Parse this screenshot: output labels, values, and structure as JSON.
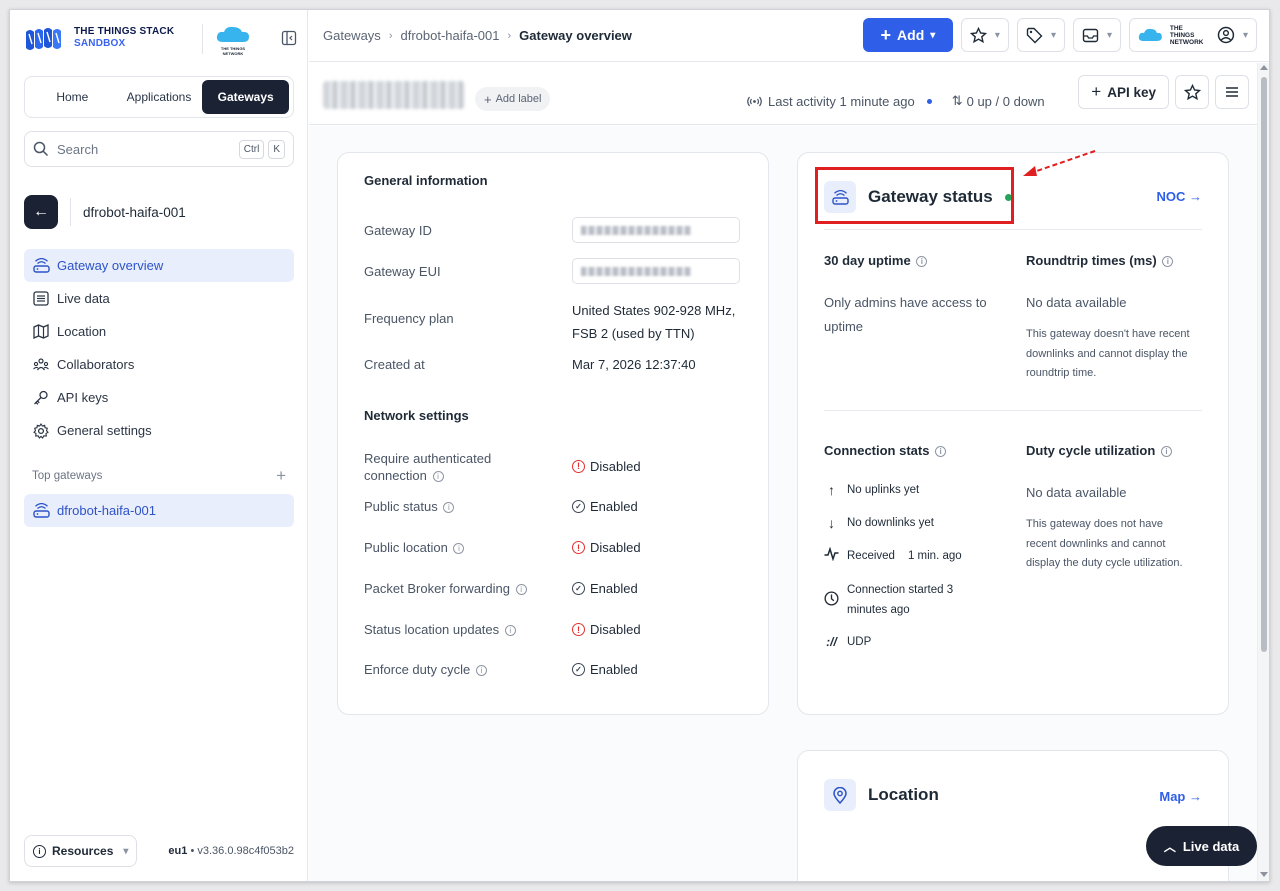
{
  "brand": {
    "line1": "THE THINGS STACK",
    "line2": "SANDBOX",
    "ttn_line1": "THE THINGS",
    "ttn_line2": "NETWORK"
  },
  "nav": {
    "tabs": [
      {
        "label": "Home"
      },
      {
        "label": "Applications"
      },
      {
        "label": "Gateways",
        "active": true
      }
    ]
  },
  "search": {
    "placeholder": "Search",
    "shortcut1": "Ctrl",
    "shortcut2": "K"
  },
  "gateway_nav": {
    "name": "dfrobot-haifa-001",
    "items": [
      {
        "label": "Gateway overview",
        "icon": "router-icon",
        "active": true
      },
      {
        "label": "Live data",
        "icon": "list-icon"
      },
      {
        "label": "Location",
        "icon": "map-icon"
      },
      {
        "label": "Collaborators",
        "icon": "people-icon"
      },
      {
        "label": "API keys",
        "icon": "key-icon"
      },
      {
        "label": "General settings",
        "icon": "gear-icon"
      }
    ]
  },
  "top_gateways": {
    "heading": "Top gateways",
    "items": [
      {
        "label": "dfrobot-haifa-001"
      }
    ]
  },
  "footer": {
    "resources_label": "Resources",
    "region": "eu1",
    "version": "v3.36.0.98c4f053b2"
  },
  "breadcrumbs": [
    {
      "label": "Gateways"
    },
    {
      "label": "dfrobot-haifa-001"
    },
    {
      "label": "Gateway overview"
    }
  ],
  "header": {
    "add_label": "Add",
    "account_ttn_line1": "THE THINGS",
    "account_ttn_line2": "NETWORK"
  },
  "subheader": {
    "add_label": "Add label",
    "last_activity": "Last activity 1 minute ago",
    "traffic": "0 up / 0 down",
    "api_key_label": "API key"
  },
  "general_info": {
    "title": "General information",
    "rows": [
      {
        "label": "Gateway ID"
      },
      {
        "label": "Gateway EUI"
      },
      {
        "label": "Frequency plan",
        "value_line1": "United States 902-928 MHz,",
        "value_line2": "FSB 2 (used by TTN)"
      },
      {
        "label": "Created at",
        "value": "Mar 7, 2026 12:37:40"
      }
    ]
  },
  "network_settings": {
    "title": "Network settings",
    "rows": [
      {
        "label_line1": "Require authenticated",
        "label_line2": "connection",
        "status": "Disabled",
        "enabled": false
      },
      {
        "label": "Public status",
        "status": "Enabled",
        "enabled": true
      },
      {
        "label": "Public location",
        "status": "Disabled",
        "enabled": false
      },
      {
        "label": "Packet Broker forwarding",
        "status": "Enabled",
        "enabled": true
      },
      {
        "label": "Status location updates",
        "status": "Disabled",
        "enabled": false
      },
      {
        "label": "Enforce duty cycle",
        "status": "Enabled",
        "enabled": true
      }
    ]
  },
  "gateway_status": {
    "title": "Gateway status",
    "noc_link": "NOC →",
    "uptime_heading": "30 day uptime",
    "uptime_line1": "Only admins have access to",
    "uptime_line2": "uptime",
    "roundtrip_heading": "Roundtrip times (ms)",
    "roundtrip_value": "No data available",
    "roundtrip_note": [
      "This gateway doesn't have recent",
      "downlinks and cannot display the",
      "roundtrip time."
    ],
    "connection_heading": "Connection stats",
    "uplinks": "No uplinks yet",
    "downlinks": "No downlinks yet",
    "received_label": "Received",
    "received_time": "1 min. ago",
    "conn_started_line1": "Connection started 3",
    "conn_started_line2": "minutes ago",
    "protocol": "UDP",
    "duty_heading": "Duty cycle utilization",
    "duty_value": "No data available",
    "duty_note": [
      "This gateway does not have",
      "recent downlinks and cannot",
      "display the duty cycle utilization."
    ],
    "status_color": "#22a55a"
  },
  "location_card": {
    "title": "Location",
    "map_link": "Map →"
  },
  "live_data_button": {
    "label": "Live data"
  },
  "colors": {
    "accent": "#2f5fe8",
    "dark": "#1a2233",
    "disabled": "#e0332f",
    "highlight": "#e02020"
  }
}
